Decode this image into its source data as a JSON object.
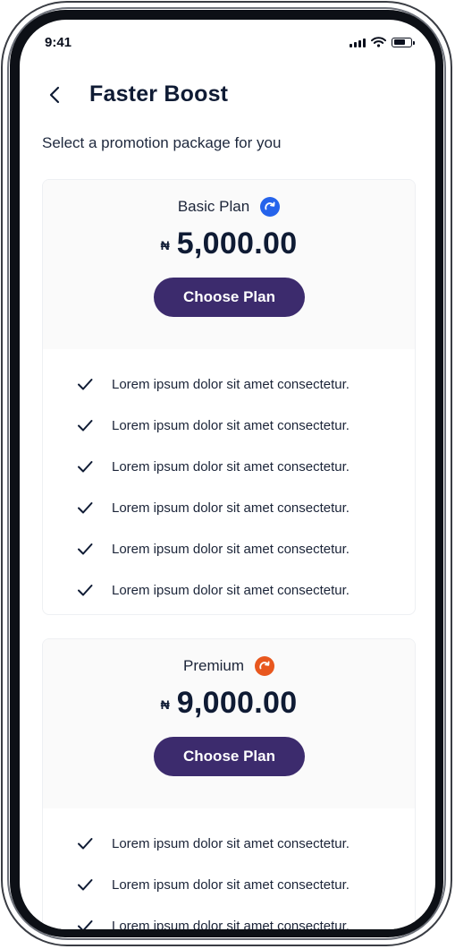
{
  "status_bar": {
    "time": "9:41",
    "signal_icon": "cellular-signal-icon",
    "wifi_icon": "wifi-icon",
    "battery_icon": "battery-icon",
    "battery_level": 0.7
  },
  "header": {
    "back_icon": "chevron-left-icon",
    "title": "Faster Boost"
  },
  "subtitle": "Select a promotion package for you",
  "plans": [
    {
      "name": "Basic Plan",
      "badge_icon": "boost-arrow-icon",
      "badge_color": "#2563eb",
      "currency_symbol": "₦",
      "price": "5,000.00",
      "button_label": "Choose Plan",
      "features": [
        "Lorem ipsum dolor sit amet consectetur.",
        "Lorem ipsum dolor sit amet consectetur.",
        "Lorem ipsum dolor sit amet consectetur.",
        "Lorem ipsum dolor sit amet consectetur.",
        "Lorem ipsum dolor sit amet consectetur.",
        "Lorem ipsum dolor sit amet consectetur."
      ]
    },
    {
      "name": "Premium",
      "badge_icon": "boost-arrow-icon",
      "badge_color": "#e8571e",
      "currency_symbol": "₦",
      "price": "9,000.00",
      "button_label": "Choose Plan",
      "features": [
        "Lorem ipsum dolor sit amet consectetur.",
        "Lorem ipsum dolor sit amet consectetur.",
        "Lorem ipsum dolor sit amet consectetur."
      ]
    }
  ],
  "colors": {
    "primary_button": "#3c2b6d",
    "text_primary": "#0f1b34",
    "card_header_bg": "#fafafa"
  }
}
